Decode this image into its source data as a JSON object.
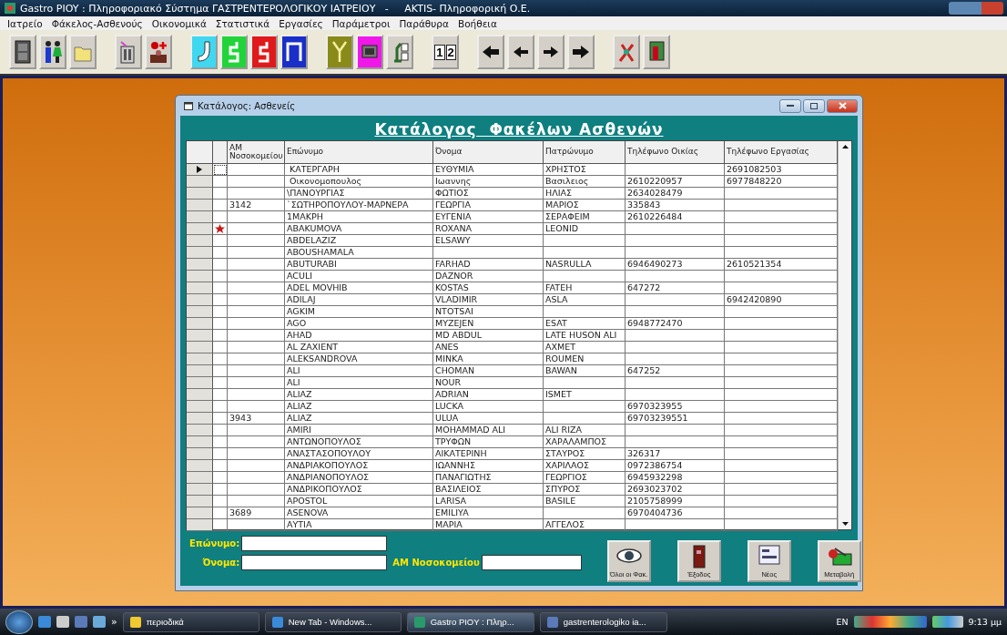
{
  "app_title": "Gastro PIOY : Πληροφοριακό Σύστημα ΓΑΣΤΡΕΝΤΕΡΟΛΟΓΙΚΟΥ ΙΑΤΡΕΙΟΥ   -     AKTIS- Πληροφορική Ο.Ε.",
  "menu": [
    "Ιατρείο",
    "Φάκελος-Ασθενούς",
    "Οικονομικά",
    "Στατιστικά",
    "Εργασίες",
    "Παράμετροι",
    "Παράθυρα",
    "Βοήθεια"
  ],
  "toolbar": [
    {
      "kind": "cabinet",
      "color": "#d4d0c8"
    },
    {
      "kind": "people",
      "color": "#d4d0c8"
    },
    {
      "kind": "folder",
      "color": "#d4d0c8"
    },
    {
      "kind": "gap"
    },
    {
      "kind": "machine",
      "color": "#d4d0c8"
    },
    {
      "kind": "doctor",
      "color": "#d4d0c8"
    },
    {
      "kind": "gap"
    },
    {
      "kind": "stomach",
      "color": "#3fd8f0"
    },
    {
      "kind": "intestine",
      "color": "#22d43a"
    },
    {
      "kind": "intestine",
      "color": "#e01a1a"
    },
    {
      "kind": "colon",
      "color": "#1a2fc8"
    },
    {
      "kind": "gap"
    },
    {
      "kind": "fork",
      "color": "#8a8a18"
    },
    {
      "kind": "monitor",
      "color": "#f018e8"
    },
    {
      "kind": "microscope",
      "color": "#d4d0c8"
    },
    {
      "kind": "gap"
    },
    {
      "kind": "pages",
      "color": "#d4d0c8",
      "labels": [
        "1",
        "2"
      ]
    },
    {
      "kind": "gap"
    },
    {
      "kind": "arrow-first",
      "color": "#d4d0c8"
    },
    {
      "kind": "arrow-left",
      "color": "#d4d0c8"
    },
    {
      "kind": "arrow-right",
      "color": "#d4d0c8"
    },
    {
      "kind": "arrow-last",
      "color": "#d4d0c8"
    },
    {
      "kind": "gap"
    },
    {
      "kind": "tools",
      "color": "#d4d0c8"
    },
    {
      "kind": "exit",
      "color": "#d4d0c8"
    }
  ],
  "window": {
    "title": "Κατάλογος: Ασθενείς",
    "heading": "Κατάλογος  Φακέλων Ασθενών"
  },
  "table": {
    "columns": [
      "AM Νοσοκομείου",
      "Επώνυμο",
      "Όνομα",
      "Πατρώνυμο",
      "Τηλέφωνο Οικίας",
      "Τηλέφωνο Εργασίας"
    ],
    "rows": [
      {
        "selected": true,
        "flagged": false,
        "cells": [
          "",
          " ΚΑΤΕΡΓΑΡΗ",
          "ΕΥΘΥΜΙΑ",
          "ΧΡΗΣΤΟΣ",
          "",
          "2691082503"
        ]
      },
      {
        "selected": false,
        "flagged": false,
        "cells": [
          "",
          " Οικονομοπουλος",
          "Ιωαννης",
          "Βασιλειος",
          "2610220957",
          "6977848220"
        ]
      },
      {
        "selected": false,
        "flagged": false,
        "cells": [
          "",
          "\\ΠΑΝΟΥΡΓΙΑΣ",
          "ΦΩΤΙΟΣ",
          "ΗΛΙΑΣ",
          "2634028479",
          ""
        ]
      },
      {
        "selected": false,
        "flagged": false,
        "cells": [
          "3142",
          "`ΣΩΤΗΡΟΠΟΥΛΟΥ-ΜΑΡΝΕΡΑ",
          "ΓΕΩΡΓΙΑ",
          "ΜΑΡΙΟΣ",
          "335843",
          ""
        ]
      },
      {
        "selected": false,
        "flagged": false,
        "cells": [
          "",
          "1ΜΑΚΡΗ",
          "ΕΥΓΕΝΙΑ",
          "ΣΕΡΑΦΕΙΜ",
          "2610226484",
          ""
        ]
      },
      {
        "selected": false,
        "flagged": true,
        "cells": [
          "",
          "ABAKUMOVA",
          "ROXANA",
          "LEONID",
          "",
          ""
        ]
      },
      {
        "selected": false,
        "flagged": false,
        "cells": [
          "",
          "ABDELAZIZ",
          "ELSAWY",
          "",
          "",
          ""
        ]
      },
      {
        "selected": false,
        "flagged": false,
        "cells": [
          "",
          "ABOUSHAMALA",
          "",
          "",
          "",
          ""
        ]
      },
      {
        "selected": false,
        "flagged": false,
        "cells": [
          "",
          "ABUTURABI",
          "FARHAD",
          "NASRULLA",
          "6946490273",
          "2610521354"
        ]
      },
      {
        "selected": false,
        "flagged": false,
        "cells": [
          "",
          "ACULI",
          "DAZNOR",
          "",
          "",
          ""
        ]
      },
      {
        "selected": false,
        "flagged": false,
        "cells": [
          "",
          "ADEL MOVHIB",
          "KOSTAS",
          "FATEH",
          "647272",
          ""
        ]
      },
      {
        "selected": false,
        "flagged": false,
        "cells": [
          "",
          "ADILAJ",
          "VLADIMIR",
          "ASLA",
          "",
          "6942420890"
        ]
      },
      {
        "selected": false,
        "flagged": false,
        "cells": [
          "",
          "AGKIM",
          "NTOTSAI",
          "",
          "",
          ""
        ]
      },
      {
        "selected": false,
        "flagged": false,
        "cells": [
          "",
          "AGO",
          "MYZEJEN",
          "ESAT",
          "6948772470",
          ""
        ]
      },
      {
        "selected": false,
        "flagged": false,
        "cells": [
          "",
          "AHAD",
          "MD ABDUL",
          "LATE HUSON ALI",
          "",
          ""
        ]
      },
      {
        "selected": false,
        "flagged": false,
        "cells": [
          "",
          "AL ZAXIENT",
          "ANES",
          "AXMET",
          "",
          ""
        ]
      },
      {
        "selected": false,
        "flagged": false,
        "cells": [
          "",
          "ALEKSANDROVA",
          "MINKA",
          "ROUMEN",
          "",
          ""
        ]
      },
      {
        "selected": false,
        "flagged": false,
        "cells": [
          "",
          "ALI",
          "CHOMAN",
          "BAWAN",
          "647252",
          ""
        ]
      },
      {
        "selected": false,
        "flagged": false,
        "cells": [
          "",
          "ALI",
          "NOUR",
          "",
          "",
          ""
        ]
      },
      {
        "selected": false,
        "flagged": false,
        "cells": [
          "",
          "ALIAZ",
          "ADRIAN",
          "ISMET",
          "",
          ""
        ]
      },
      {
        "selected": false,
        "flagged": false,
        "cells": [
          "",
          "ALIAZ",
          "LUCKA",
          "",
          "6970323955",
          ""
        ]
      },
      {
        "selected": false,
        "flagged": false,
        "cells": [
          "3943",
          "ALIAZ",
          "ULUA",
          "",
          "69703239551",
          ""
        ]
      },
      {
        "selected": false,
        "flagged": false,
        "cells": [
          "",
          "AMIRI",
          "MOHAMMAD ALI",
          "ALI RIZA",
          "",
          ""
        ]
      },
      {
        "selected": false,
        "flagged": false,
        "cells": [
          "",
          "ΑΝΤΩΝΟΠΟΥΛΟΣ",
          "ΤΡΥΦΩΝ",
          "ΧΑΡΑΛΑΜΠΟΣ",
          "",
          ""
        ]
      },
      {
        "selected": false,
        "flagged": false,
        "cells": [
          "",
          "ΑΝΑΣΤΑΣΟΠΟΥΛΟΥ",
          "ΑΙΚΑΤΕΡΙΝΗ",
          "ΣΤΑΥΡΟΣ",
          "326317",
          ""
        ]
      },
      {
        "selected": false,
        "flagged": false,
        "cells": [
          "",
          "ΑΝΔΡΙΑΚΟΠΟΥΛΟΣ",
          "ΙΩΑΝΝΗΣ",
          "ΧΑΡΙΛΑΟΣ",
          "0972386754",
          ""
        ]
      },
      {
        "selected": false,
        "flagged": false,
        "cells": [
          "",
          "ΑΝΔΡΙΑΝΟΠΟΥΛΟΣ",
          "ΠΑΝΑΓΙΩΤΗΣ",
          "ΓΕΩΡΓΙΟΣ",
          "6945932298",
          ""
        ]
      },
      {
        "selected": false,
        "flagged": false,
        "cells": [
          "",
          "ΑΝΔΡΙΚΟΠΟΥΛΟΣ",
          "ΒΑΣΙΛΕΙΟΣ",
          "ΣΠΥΡΟΣ",
          "2693023702",
          ""
        ]
      },
      {
        "selected": false,
        "flagged": false,
        "cells": [
          "",
          "APOSTOL",
          "LARISA",
          "BASILE",
          "2105758999",
          ""
        ]
      },
      {
        "selected": false,
        "flagged": false,
        "cells": [
          "3689",
          "ASENOVA",
          "EMILIYA",
          "",
          "6970404736",
          ""
        ]
      },
      {
        "selected": false,
        "flagged": false,
        "cells": [
          "",
          "ΑΥΤΙΑ",
          "ΜΑΡΙΑ",
          "ΑΓΓΕΛΟΣ",
          "",
          ""
        ]
      }
    ]
  },
  "search": {
    "surname_label": "Επώνυμο:",
    "name_label": "Όνομα:",
    "am_label": "ΑΜ Νοσοκομείου"
  },
  "buttons": [
    {
      "kind": "eye",
      "label": "Όλοι οι Φακ."
    },
    {
      "kind": "door",
      "label": "Έξοδος"
    },
    {
      "kind": "form",
      "label": "Νέος"
    },
    {
      "kind": "edit",
      "label": "Μεταβολή"
    }
  ],
  "taskbar": {
    "items": [
      {
        "kind": "folder",
        "label": "περιοδικά",
        "selected": false
      },
      {
        "kind": "browser",
        "label": "New Tab - Windows...",
        "selected": false
      },
      {
        "kind": "app",
        "label": "Gastro PIOY : Πληρ...",
        "selected": true
      },
      {
        "kind": "doc",
        "label": "gastrenterologiko ia...",
        "selected": false
      }
    ],
    "overflow": "»",
    "language": "EN",
    "clock": "9:13 μμ"
  }
}
